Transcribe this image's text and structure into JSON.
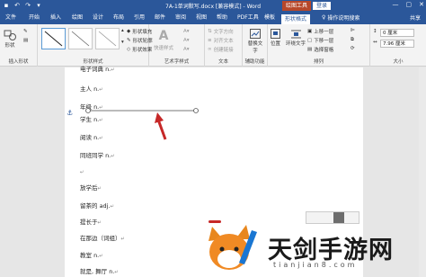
{
  "window": {
    "title": "7A-1单词默写.docx [兼容模式] - Word",
    "context_tab": "绘图工具",
    "login_label": "登录",
    "controls": [
      "—",
      "▢",
      "✕"
    ]
  },
  "tabs": [
    "文件",
    "开始",
    "插入",
    "绘图",
    "设计",
    "布局",
    "引用",
    "邮件",
    "审阅",
    "视图",
    "帮助",
    "PDF工具",
    "模板",
    "形状格式"
  ],
  "active_tab": "形状格式",
  "tell_me": "操作说明搜索",
  "share_label": "共享",
  "ribbon": {
    "insert_shapes": {
      "label": "插入形状",
      "shapes_button": "形状"
    },
    "shape_styles": {
      "label": "形状样式",
      "fill": "形状填充",
      "outline": "形状轮廓",
      "effects": "形状效果"
    },
    "wordart": {
      "label": "艺术字样式",
      "quick_styles": "快速样式"
    },
    "text": {
      "label": "文本",
      "direction": "文字方向",
      "align": "对齐文本",
      "link": "创建链接"
    },
    "accessibility": {
      "label": "辅助功能",
      "alt_text": "替换文字"
    },
    "arrange": {
      "label": "排列",
      "position": "位置",
      "wrap": "环绕文字",
      "forward": "上移一层",
      "backward": "下移一层",
      "pane": "选择窗格"
    },
    "size": {
      "label": "大小",
      "height": "0 厘米",
      "width": "7.96 厘米"
    }
  },
  "document": {
    "lines": [
      "电子词典 n.",
      "主人 n.",
      "年级 n.",
      "学生 n.",
      "阅读 n.",
      "同班同学 n.",
      "",
      "放学后",
      "留茶的 adj.",
      "提长于",
      "在那边（词组）",
      "教室 n.",
      "就是, 舞厅 n."
    ]
  },
  "colors": {
    "title_blue": "#2b579a",
    "context_red": "#b7472a",
    "arrow_red": "#c62828",
    "line_gray": "#777777"
  },
  "watermark": {
    "text": "天剑手游网",
    "url": "tianjian8.com"
  }
}
